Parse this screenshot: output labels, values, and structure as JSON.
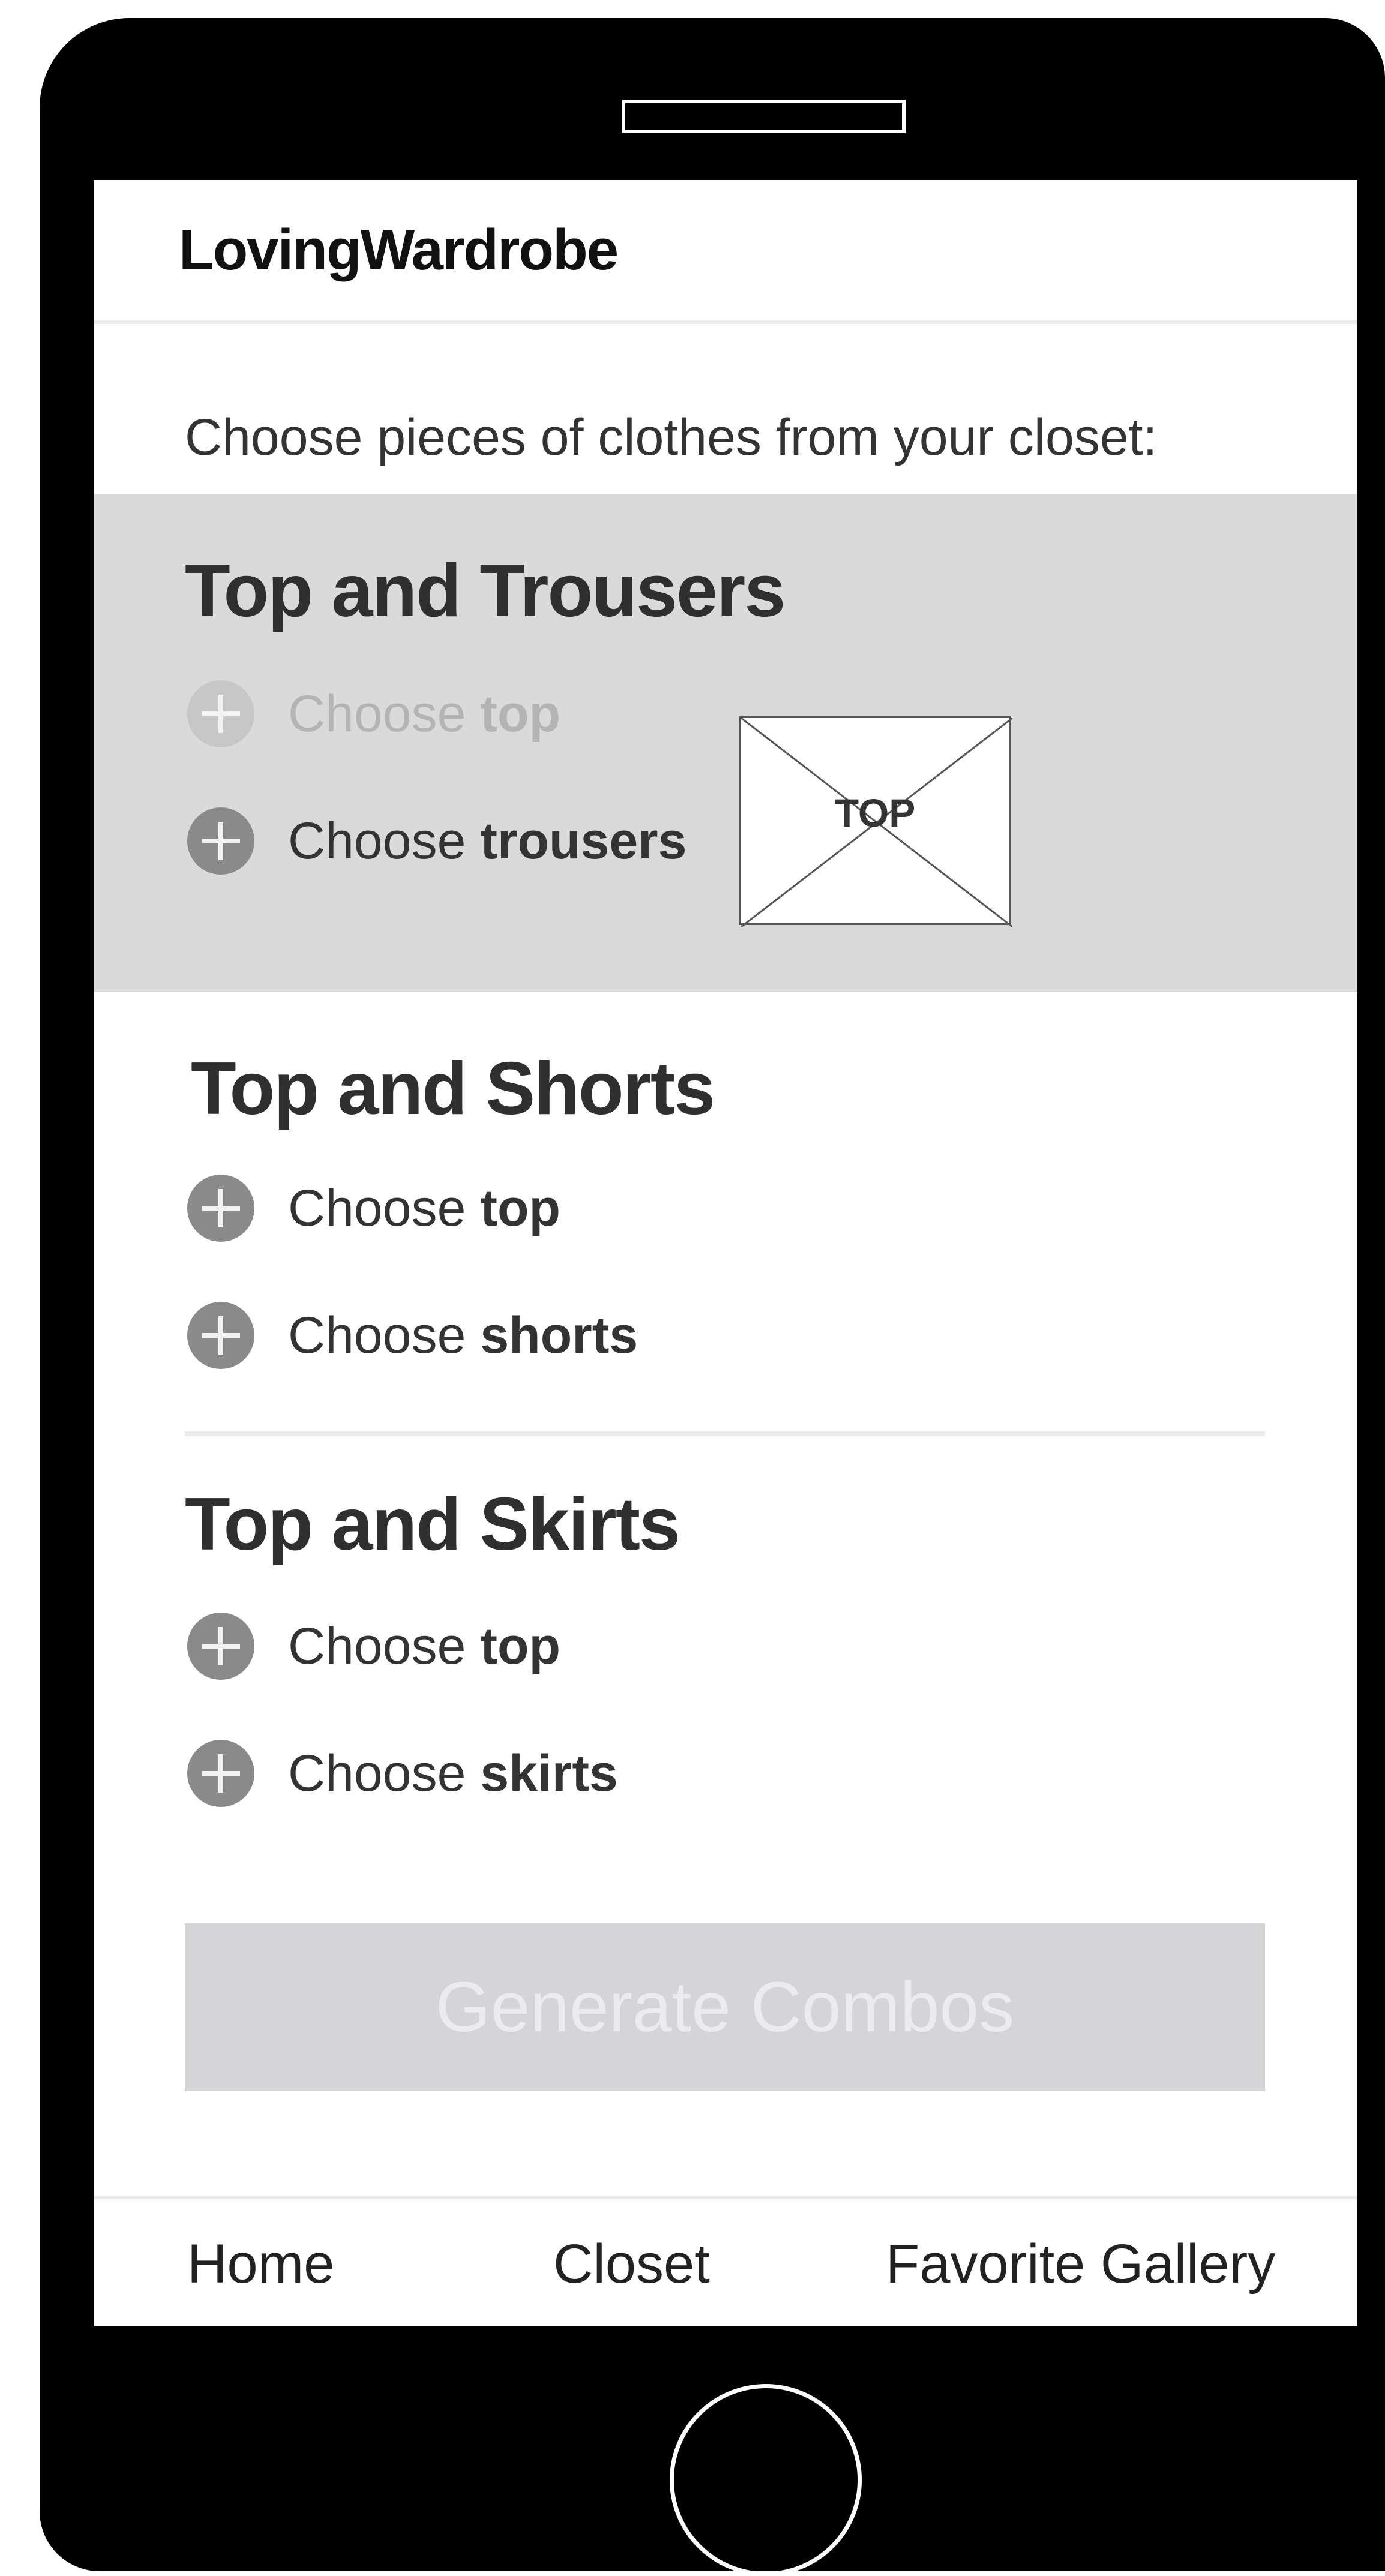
{
  "app": {
    "title": "LovingWardrobe"
  },
  "instruction": "Choose pieces of clothes from your closet:",
  "sections": [
    {
      "title": "Top and Trousers",
      "items": [
        {
          "prefix": "Choose",
          "target": "top",
          "state": "disabled"
        },
        {
          "prefix": "Choose",
          "target": "trousers",
          "state": "enabled"
        }
      ],
      "thumbnail_label": "TOP"
    },
    {
      "title": "Top and Shorts",
      "items": [
        {
          "prefix": "Choose",
          "target": "top"
        },
        {
          "prefix": "Choose",
          "target": "shorts"
        }
      ]
    },
    {
      "title": "Top and Skirts",
      "items": [
        {
          "prefix": "Choose",
          "target": "top"
        },
        {
          "prefix": "Choose",
          "target": "skirts"
        }
      ]
    }
  ],
  "generate_button": {
    "label": "Generate Combos",
    "state": "disabled"
  },
  "nav": {
    "items": [
      "Home",
      "Closet",
      "Favorite Gallery"
    ]
  },
  "colors": {
    "device": "#000000",
    "highlight_section": "#dadada",
    "icon": "#8a8a8a",
    "icon_disabled": "#c7c7c7",
    "button_disabled": "#d5d5d7"
  },
  "icons": {
    "add": "plus-circle-icon",
    "image_placeholder": "image-placeholder-icon"
  }
}
